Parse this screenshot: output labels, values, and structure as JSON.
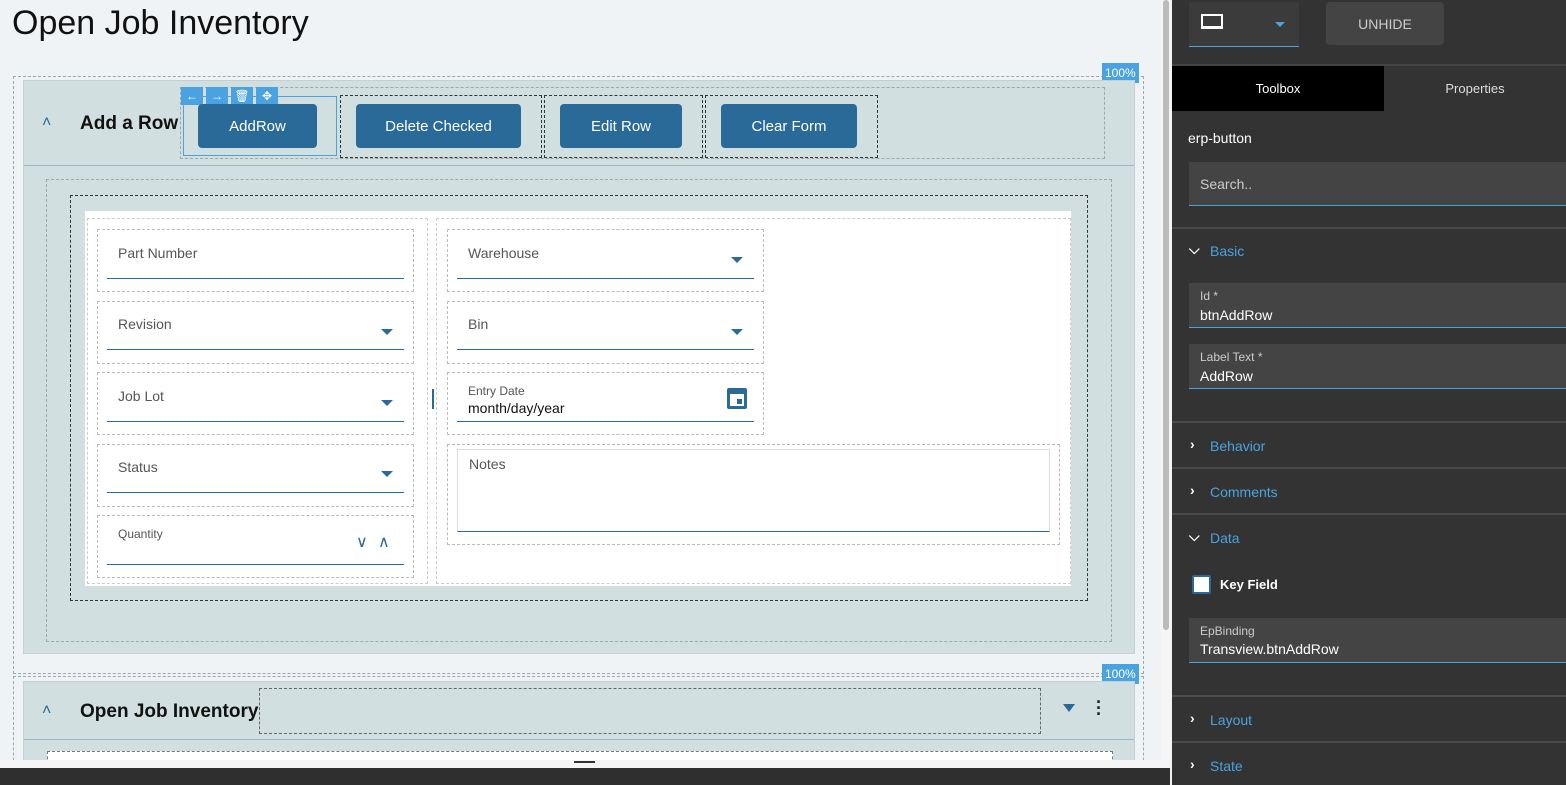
{
  "page_title": "Open Job Inventory",
  "add_row_card": {
    "title": "Add a Row",
    "zoom": "100%",
    "buttons": [
      "AddRow",
      "Delete Checked",
      "Edit Row",
      "Clear Form"
    ],
    "tools": [
      "←",
      "→",
      "🗑",
      "✥"
    ]
  },
  "form": {
    "left": [
      {
        "label": "Part Number",
        "type": "text"
      },
      {
        "label": "Revision",
        "type": "select"
      },
      {
        "label": "Job Lot",
        "type": "select"
      },
      {
        "label": "Status",
        "type": "select"
      },
      {
        "label": "Quantity",
        "type": "number"
      }
    ],
    "warehouse": "Warehouse",
    "bin": "Bin",
    "entry_date_label": "Entry Date",
    "entry_date_placeholder": "month/day/year",
    "notes": "Notes"
  },
  "grid_card": {
    "title": "Open Job Inventory",
    "zoom": "100%"
  },
  "panel": {
    "unhide": "UNHIDE",
    "tabs": [
      "Toolbox",
      "Properties"
    ],
    "component": "erp-button",
    "search_placeholder": "Search..",
    "sections": {
      "basic": "Basic",
      "behavior": "Behavior",
      "comments": "Comments",
      "data": "Data",
      "layout": "Layout",
      "state": "State"
    },
    "id_label": "Id *",
    "id_value": "btnAddRow",
    "labeltext_label": "Label Text *",
    "labeltext_value": "AddRow",
    "key_field": "Key Field",
    "key_field_checked": false,
    "epbinding_label": "EpBinding",
    "epbinding_value": "Transview.btnAddRow"
  },
  "colors": {
    "accent": "#2a6a99",
    "highlight": "#4aa3e0",
    "card": "#d2dfe0",
    "panel": "#333333"
  }
}
